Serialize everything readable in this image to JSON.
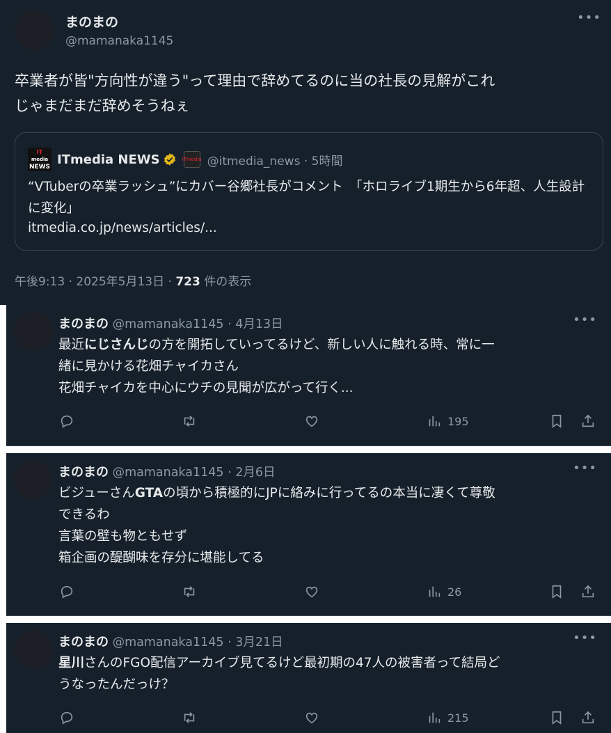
{
  "main_post": {
    "display_name": "まのまの",
    "handle": "@mamanaka1145",
    "more_icon": "more-dots-icon",
    "text_line1": "卒業者が皆\"方向性が違う\"って理由で辞めてるのに当の社長の見解がこれ",
    "text_line2": "じゃまだまだ辞めそうねぇ",
    "quote": {
      "logo_top": "IT",
      "logo_mid": "media",
      "logo_bottom": "NEWS",
      "name": "ITmedia NEWS",
      "verified_icon": "verified-gold-badge-icon",
      "sub_logo": "ITmedia",
      "handle_time": "@itmedia_news · 5時間",
      "text": "“VTuberの卒業ラッシュ”にカバー谷郷社長がコメント　「ホロライブ1期生から6年超、人生設計に変化」",
      "link": "itmedia.co.jp/news/articles/..."
    },
    "meta_prefix": "午後9:13 · 2025年5月13日 · ",
    "views": "723",
    "views_suffix": " 件の表示"
  },
  "replies": [
    {
      "display_name": "まのまの",
      "handle_date": "@mamanaka1145 · 4月13日",
      "line1_pre": "最近",
      "line1_bold": "にじさんじ",
      "line1_post": "の方を開拓していってるけど、新しい人に触れる時、常に一",
      "line2": "緒に見かける花畑チャイカさん",
      "line3": "花畑チャイカを中心にウチの見聞が広がって行く...",
      "views": "195"
    },
    {
      "display_name": "まのまの",
      "handle_date": "@mamanaka1145 · 2月6日",
      "line1_pre": "ビジューさん",
      "line1_bold": "GTA",
      "line1_post": "の頃から積極的にJPに絡みに行ってるの本当に凄くて尊敬",
      "line2": "できるわ",
      "line3": "言葉の壁も物ともせず",
      "line4": "箱企画の醍醐味を存分に堪能してる",
      "views": "26"
    },
    {
      "display_name": "まのまの",
      "handle_date": "@mamanaka1145 · 3月21日",
      "line1_bold": "星川",
      "line1_post": "さんのFGO配信アーカイブ見てるけど最初期の47人の被害者って結局ど",
      "line2": "うなったんだっけ？",
      "views": "215"
    }
  ],
  "colors": {
    "background": "#15202b",
    "text": "#e7e9ea",
    "muted": "#8b98a5",
    "border": "#38444d",
    "verified": "#e2b719"
  }
}
